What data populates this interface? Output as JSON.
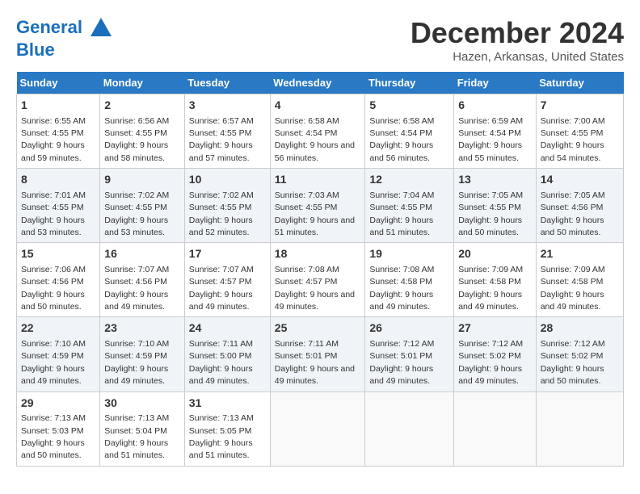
{
  "header": {
    "logo_line1": "General",
    "logo_line2": "Blue",
    "title": "December 2024",
    "location": "Hazen, Arkansas, United States"
  },
  "weekdays": [
    "Sunday",
    "Monday",
    "Tuesday",
    "Wednesday",
    "Thursday",
    "Friday",
    "Saturday"
  ],
  "weeks": [
    [
      {
        "day": "1",
        "sunrise": "6:55 AM",
        "sunset": "4:55 PM",
        "daylight": "9 hours and 59 minutes."
      },
      {
        "day": "2",
        "sunrise": "6:56 AM",
        "sunset": "4:55 PM",
        "daylight": "9 hours and 58 minutes."
      },
      {
        "day": "3",
        "sunrise": "6:57 AM",
        "sunset": "4:55 PM",
        "daylight": "9 hours and 57 minutes."
      },
      {
        "day": "4",
        "sunrise": "6:58 AM",
        "sunset": "4:54 PM",
        "daylight": "9 hours and 56 minutes."
      },
      {
        "day": "5",
        "sunrise": "6:58 AM",
        "sunset": "4:54 PM",
        "daylight": "9 hours and 56 minutes."
      },
      {
        "day": "6",
        "sunrise": "6:59 AM",
        "sunset": "4:54 PM",
        "daylight": "9 hours and 55 minutes."
      },
      {
        "day": "7",
        "sunrise": "7:00 AM",
        "sunset": "4:55 PM",
        "daylight": "9 hours and 54 minutes."
      }
    ],
    [
      {
        "day": "8",
        "sunrise": "7:01 AM",
        "sunset": "4:55 PM",
        "daylight": "9 hours and 53 minutes."
      },
      {
        "day": "9",
        "sunrise": "7:02 AM",
        "sunset": "4:55 PM",
        "daylight": "9 hours and 53 minutes."
      },
      {
        "day": "10",
        "sunrise": "7:02 AM",
        "sunset": "4:55 PM",
        "daylight": "9 hours and 52 minutes."
      },
      {
        "day": "11",
        "sunrise": "7:03 AM",
        "sunset": "4:55 PM",
        "daylight": "9 hours and 51 minutes."
      },
      {
        "day": "12",
        "sunrise": "7:04 AM",
        "sunset": "4:55 PM",
        "daylight": "9 hours and 51 minutes."
      },
      {
        "day": "13",
        "sunrise": "7:05 AM",
        "sunset": "4:55 PM",
        "daylight": "9 hours and 50 minutes."
      },
      {
        "day": "14",
        "sunrise": "7:05 AM",
        "sunset": "4:56 PM",
        "daylight": "9 hours and 50 minutes."
      }
    ],
    [
      {
        "day": "15",
        "sunrise": "7:06 AM",
        "sunset": "4:56 PM",
        "daylight": "9 hours and 50 minutes."
      },
      {
        "day": "16",
        "sunrise": "7:07 AM",
        "sunset": "4:56 PM",
        "daylight": "9 hours and 49 minutes."
      },
      {
        "day": "17",
        "sunrise": "7:07 AM",
        "sunset": "4:57 PM",
        "daylight": "9 hours and 49 minutes."
      },
      {
        "day": "18",
        "sunrise": "7:08 AM",
        "sunset": "4:57 PM",
        "daylight": "9 hours and 49 minutes."
      },
      {
        "day": "19",
        "sunrise": "7:08 AM",
        "sunset": "4:58 PM",
        "daylight": "9 hours and 49 minutes."
      },
      {
        "day": "20",
        "sunrise": "7:09 AM",
        "sunset": "4:58 PM",
        "daylight": "9 hours and 49 minutes."
      },
      {
        "day": "21",
        "sunrise": "7:09 AM",
        "sunset": "4:58 PM",
        "daylight": "9 hours and 49 minutes."
      }
    ],
    [
      {
        "day": "22",
        "sunrise": "7:10 AM",
        "sunset": "4:59 PM",
        "daylight": "9 hours and 49 minutes."
      },
      {
        "day": "23",
        "sunrise": "7:10 AM",
        "sunset": "4:59 PM",
        "daylight": "9 hours and 49 minutes."
      },
      {
        "day": "24",
        "sunrise": "7:11 AM",
        "sunset": "5:00 PM",
        "daylight": "9 hours and 49 minutes."
      },
      {
        "day": "25",
        "sunrise": "7:11 AM",
        "sunset": "5:01 PM",
        "daylight": "9 hours and 49 minutes."
      },
      {
        "day": "26",
        "sunrise": "7:12 AM",
        "sunset": "5:01 PM",
        "daylight": "9 hours and 49 minutes."
      },
      {
        "day": "27",
        "sunrise": "7:12 AM",
        "sunset": "5:02 PM",
        "daylight": "9 hours and 49 minutes."
      },
      {
        "day": "28",
        "sunrise": "7:12 AM",
        "sunset": "5:02 PM",
        "daylight": "9 hours and 50 minutes."
      }
    ],
    [
      {
        "day": "29",
        "sunrise": "7:13 AM",
        "sunset": "5:03 PM",
        "daylight": "9 hours and 50 minutes."
      },
      {
        "day": "30",
        "sunrise": "7:13 AM",
        "sunset": "5:04 PM",
        "daylight": "9 hours and 51 minutes."
      },
      {
        "day": "31",
        "sunrise": "7:13 AM",
        "sunset": "5:05 PM",
        "daylight": "9 hours and 51 minutes."
      },
      null,
      null,
      null,
      null
    ]
  ]
}
